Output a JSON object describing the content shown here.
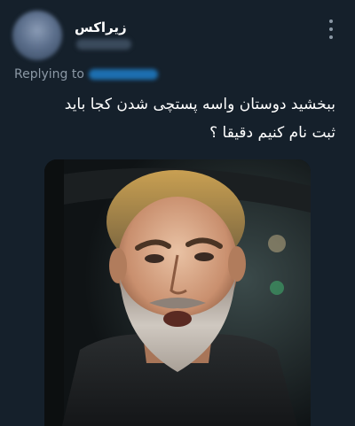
{
  "tweet": {
    "display_name": "زیراکس",
    "reply_label": "Replying to",
    "text_lines": [
      "ببخشید دوستان واسه پستچی شدن کجا باید",
      "ثبت نام کنیم دقیقا ؟"
    ],
    "more_icon": "more-vertical-icon"
  },
  "colors": {
    "background": "#15202b",
    "secondary_text": "#8b98a5",
    "link": "#1d9bf0"
  }
}
